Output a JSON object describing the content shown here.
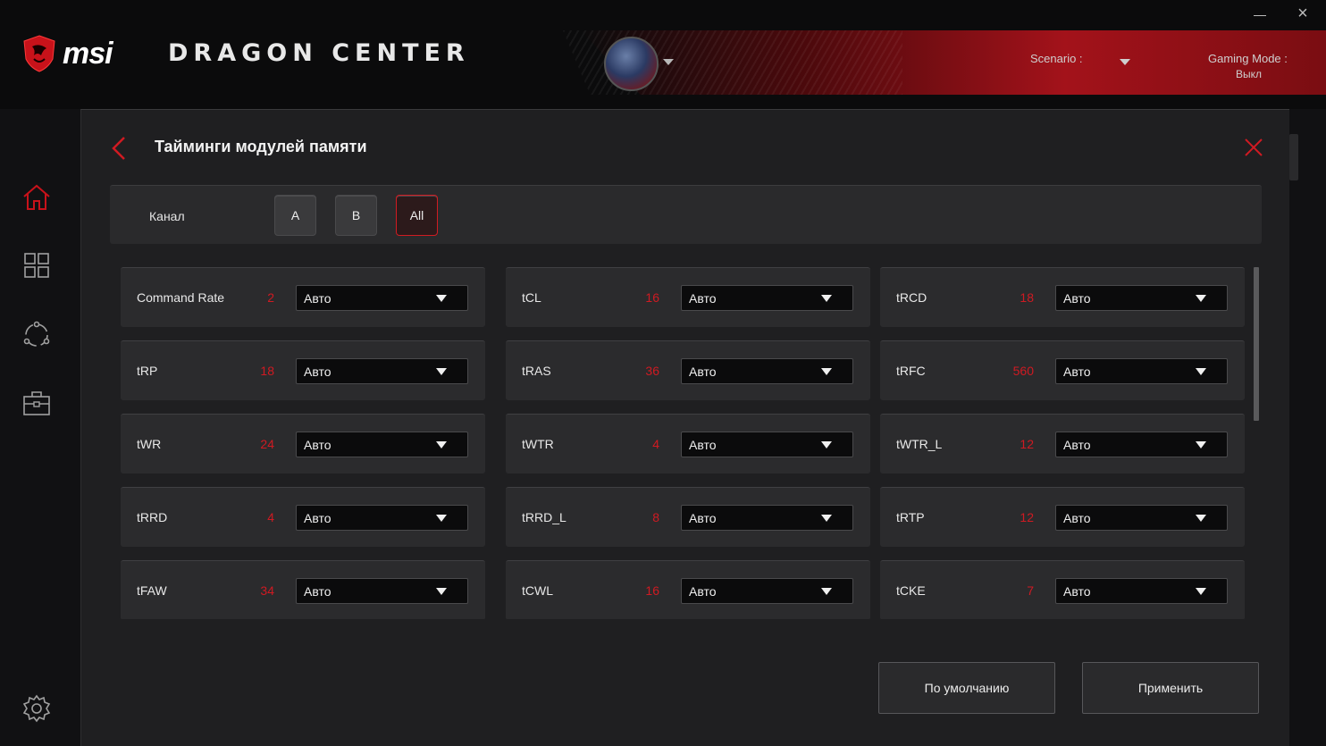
{
  "header": {
    "logo_text": "msi",
    "app_title": "DRAGON CENTER",
    "scenario_label": "Scenario :",
    "gaming_mode_label": "Gaming Mode :",
    "gaming_mode_value": "Выкл",
    "minimize_icon": "minimize-icon",
    "close_icon": "×",
    "accent_color": "#a3121a"
  },
  "sidebar": {
    "items": [
      {
        "name": "home",
        "icon": "home-icon",
        "active": true
      },
      {
        "name": "apps",
        "icon": "grid-icon",
        "active": false
      },
      {
        "name": "network",
        "icon": "network-icon",
        "active": false
      },
      {
        "name": "toolbox",
        "icon": "toolbox-icon",
        "active": false
      }
    ],
    "settings_icon": "gear-icon"
  },
  "dialog": {
    "title": "Тайминги модулей памяти",
    "channel": {
      "label": "Канал",
      "buttons": [
        {
          "label": "A",
          "active": false
        },
        {
          "label": "B",
          "active": false
        },
        {
          "label": "All",
          "active": true
        }
      ]
    },
    "timings": [
      {
        "name": "Command Rate",
        "value": "2",
        "select": "Авто"
      },
      {
        "name": "tCL",
        "value": "16",
        "select": "Авто"
      },
      {
        "name": "tRCD",
        "value": "18",
        "select": "Авто"
      },
      {
        "name": "tRP",
        "value": "18",
        "select": "Авто"
      },
      {
        "name": "tRAS",
        "value": "36",
        "select": "Авто"
      },
      {
        "name": "tRFC",
        "value": "560",
        "select": "Авто"
      },
      {
        "name": "tWR",
        "value": "24",
        "select": "Авто"
      },
      {
        "name": "tWTR",
        "value": "4",
        "select": "Авто"
      },
      {
        "name": "tWTR_L",
        "value": "12",
        "select": "Авто"
      },
      {
        "name": "tRRD",
        "value": "4",
        "select": "Авто"
      },
      {
        "name": "tRRD_L",
        "value": "8",
        "select": "Авто"
      },
      {
        "name": "tRTP",
        "value": "12",
        "select": "Авто"
      },
      {
        "name": "tFAW",
        "value": "34",
        "select": "Авто"
      },
      {
        "name": "tCWL",
        "value": "16",
        "select": "Авто"
      },
      {
        "name": "tCKE",
        "value": "7",
        "select": "Авто"
      }
    ],
    "default_button": "По умолчанию",
    "apply_button": "Применить",
    "value_color": "#d01a22"
  }
}
